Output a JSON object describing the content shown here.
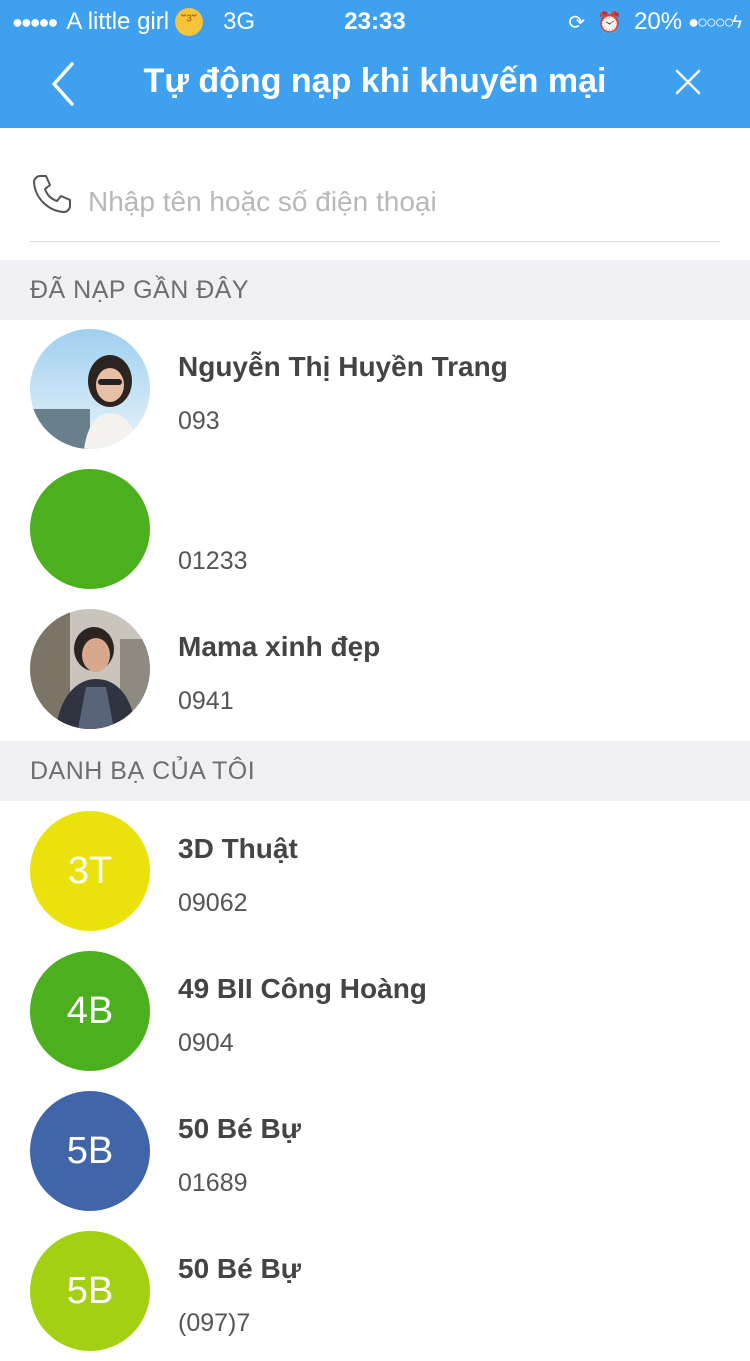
{
  "status": {
    "carrier": "A little girl",
    "network": "3G",
    "time": "23:33",
    "battery": "20%"
  },
  "nav": {
    "title": "Tự động nạp khi khuyến mại"
  },
  "search": {
    "placeholder": "Nhập tên hoặc số điện thoại"
  },
  "sections": {
    "recent": "ĐÃ NẠP GẦN ĐÂY",
    "contacts": "DANH BẠ CỦA TÔI"
  },
  "recent": [
    {
      "name": "Nguyễn Thị Huyền Trang",
      "phone": "093"
    },
    {
      "name": "",
      "phone": "01233"
    },
    {
      "name": "Mama xinh đẹp",
      "phone": "0941"
    }
  ],
  "contacts": [
    {
      "initials": "3T",
      "name": "3D Thuật",
      "phone": "09062",
      "color": "#ebe20c"
    },
    {
      "initials": "4B",
      "name": "49 BII Công Hoàng",
      "phone": "0904",
      "color": "#4caf1e"
    },
    {
      "initials": "5B",
      "name": "50 Bé Bự",
      "phone": "01689",
      "color": "#4065a8"
    },
    {
      "initials": "5B",
      "name": "50 Bé Bự",
      "phone": "(097)7",
      "color": "#a3d012"
    }
  ],
  "colors": {
    "header": "#3ea0ee",
    "recent_green": "#4caf1e"
  }
}
